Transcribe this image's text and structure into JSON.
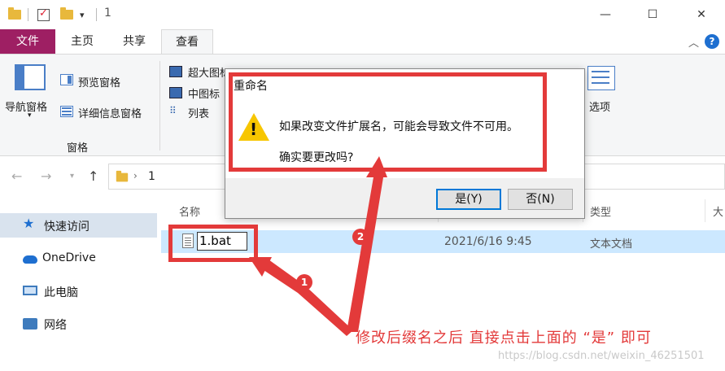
{
  "window": {
    "title": "1"
  },
  "tabs": {
    "file": "文件",
    "home": "主页",
    "share": "共享",
    "view": "查看"
  },
  "ribbon": {
    "nav_pane": "导航窗格",
    "preview_pane": "预览窗格",
    "details_pane": "详细信息窗格",
    "group_panes": "窗格",
    "extra_large_icons": "超大图标",
    "medium_icons": "中图标",
    "list": "列表",
    "options": "选项"
  },
  "address": {
    "crumb": "1"
  },
  "sidebar": {
    "items": [
      {
        "label": "快速访问"
      },
      {
        "label": "OneDrive"
      },
      {
        "label": "此电脑"
      },
      {
        "label": "网络"
      }
    ]
  },
  "columns": {
    "name": "名称",
    "type": "类型",
    "size": "大"
  },
  "file": {
    "name": "1.bat",
    "date": "2021/6/16 9:45",
    "type": "文本文档"
  },
  "dialog": {
    "title": "重命名",
    "message": "如果改变文件扩展名，可能会导致文件不可用。",
    "question": "确实要更改吗?",
    "yes": "是(Y)",
    "no": "否(N)"
  },
  "annotation": {
    "badge1": "1",
    "badge2": "2",
    "text": "修改后缀名之后 直接点击上面的 “是” 即可",
    "watermark": "https://blog.csdn.net/weixin_46251501",
    "color": "#e33a3a"
  }
}
